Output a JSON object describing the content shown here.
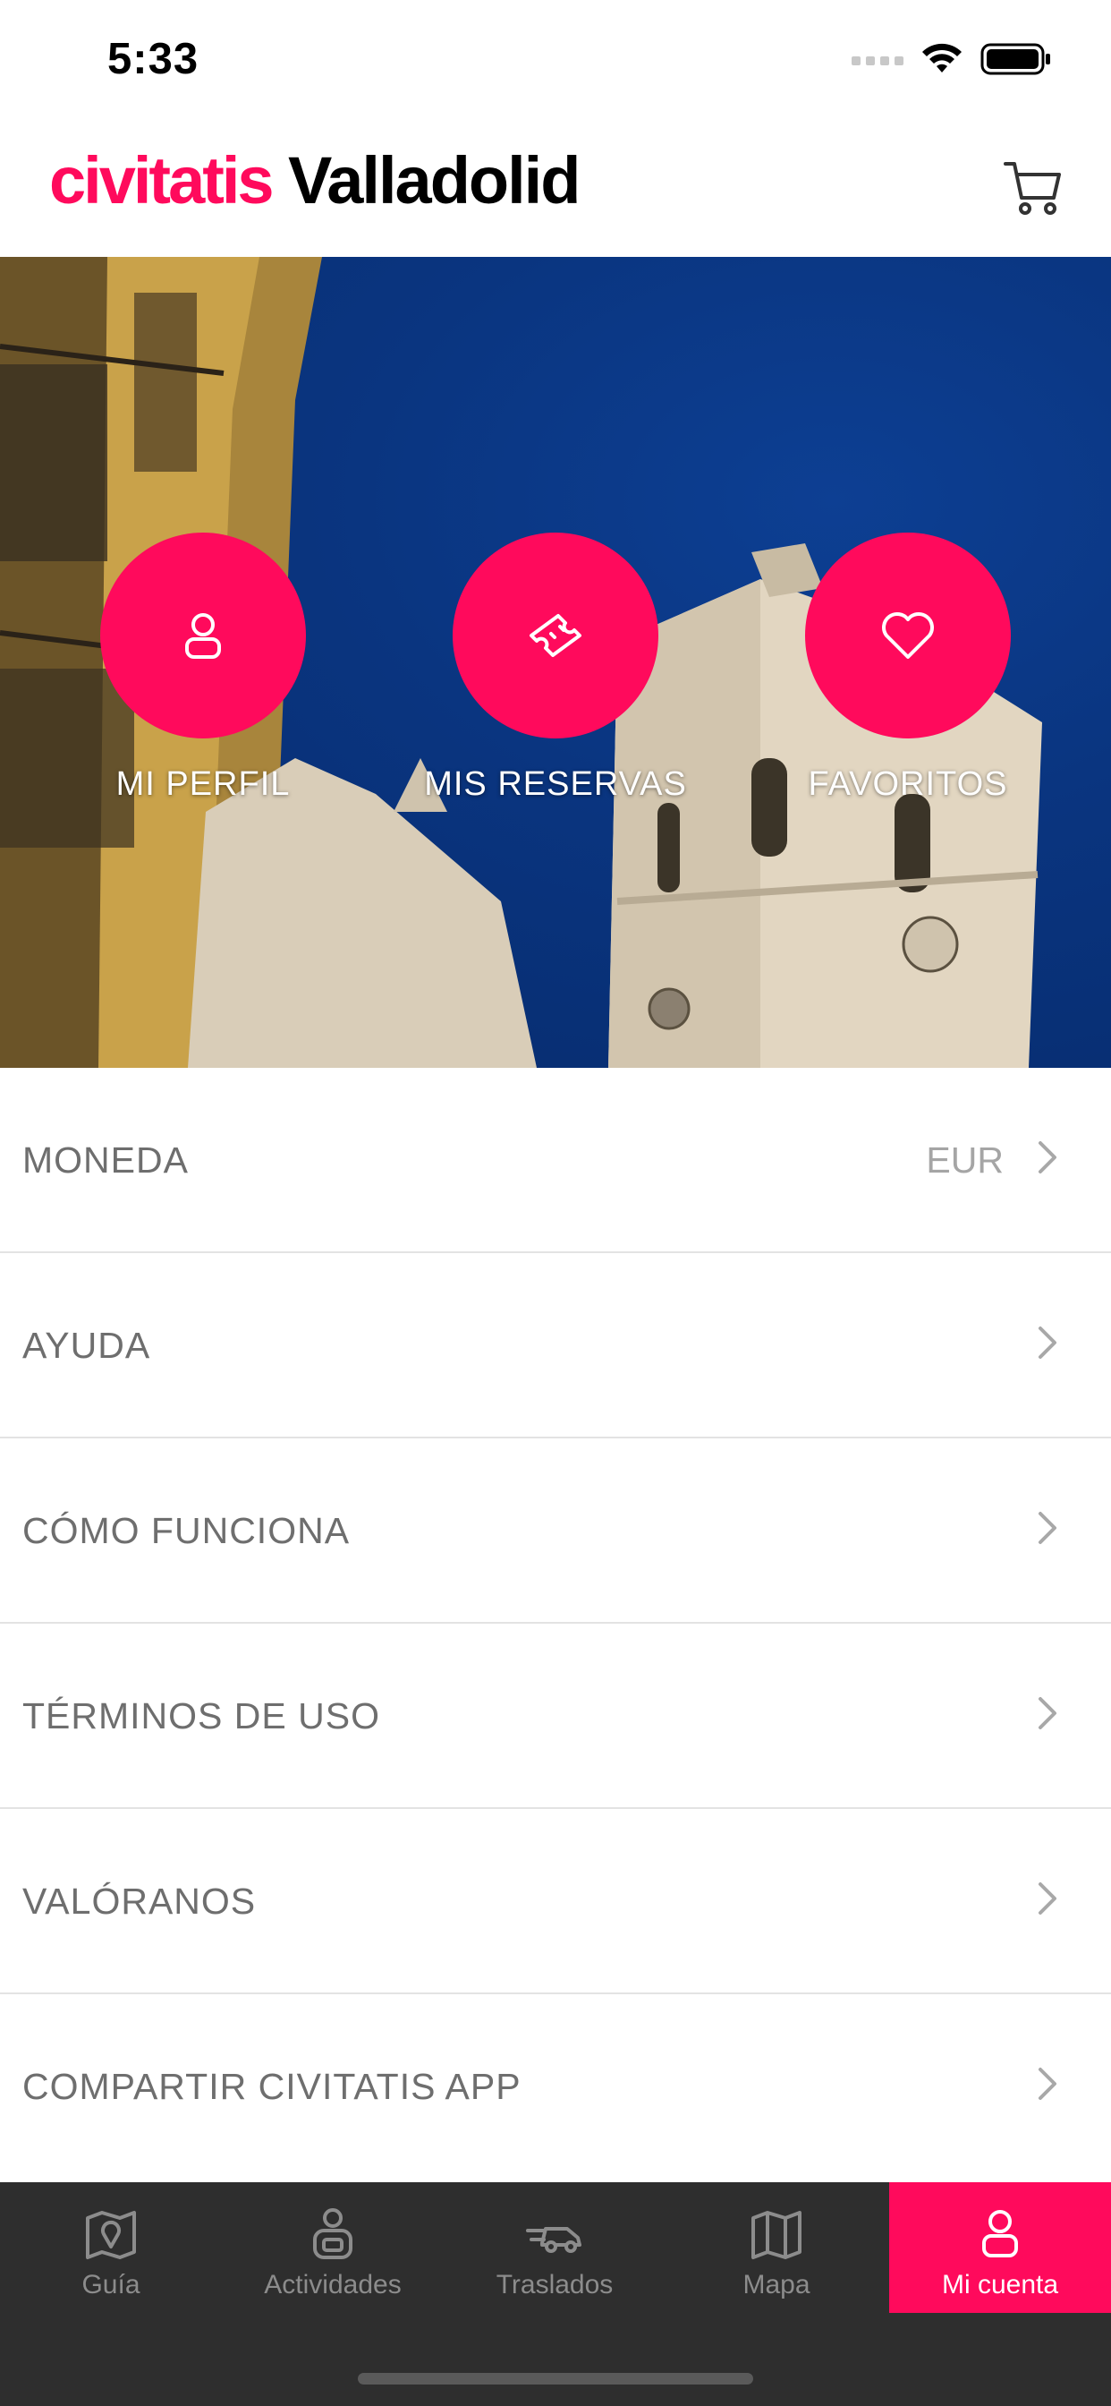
{
  "status": {
    "time": "5:33"
  },
  "header": {
    "brand": "civitatis",
    "city": "Valladolid"
  },
  "hero": {
    "buttons": [
      {
        "label": "MI PERFIL",
        "icon": "user-icon"
      },
      {
        "label": "MIS RESERVAS",
        "icon": "ticket-icon"
      },
      {
        "label": "FAVORITOS",
        "icon": "heart-icon"
      }
    ]
  },
  "menu": {
    "items": [
      {
        "label": "MONEDA",
        "value": "EUR"
      },
      {
        "label": "AYUDA"
      },
      {
        "label": "CÓMO FUNCIONA"
      },
      {
        "label": "TÉRMINOS DE USO"
      },
      {
        "label": "VALÓRANOS"
      },
      {
        "label": "COMPARTIR CIVITATIS APP"
      }
    ]
  },
  "tabbar": {
    "tabs": [
      {
        "label": "Guía",
        "icon": "map-pin-icon"
      },
      {
        "label": "Actividades",
        "icon": "tourist-icon"
      },
      {
        "label": "Traslados",
        "icon": "car-icon"
      },
      {
        "label": "Mapa",
        "icon": "map-icon"
      },
      {
        "label": "Mi cuenta",
        "icon": "user-icon",
        "active": true
      }
    ]
  },
  "colors": {
    "accent": "#ff0a5c",
    "tabbar_bg": "#2e2e2e",
    "menu_text": "#6e6e6e"
  }
}
